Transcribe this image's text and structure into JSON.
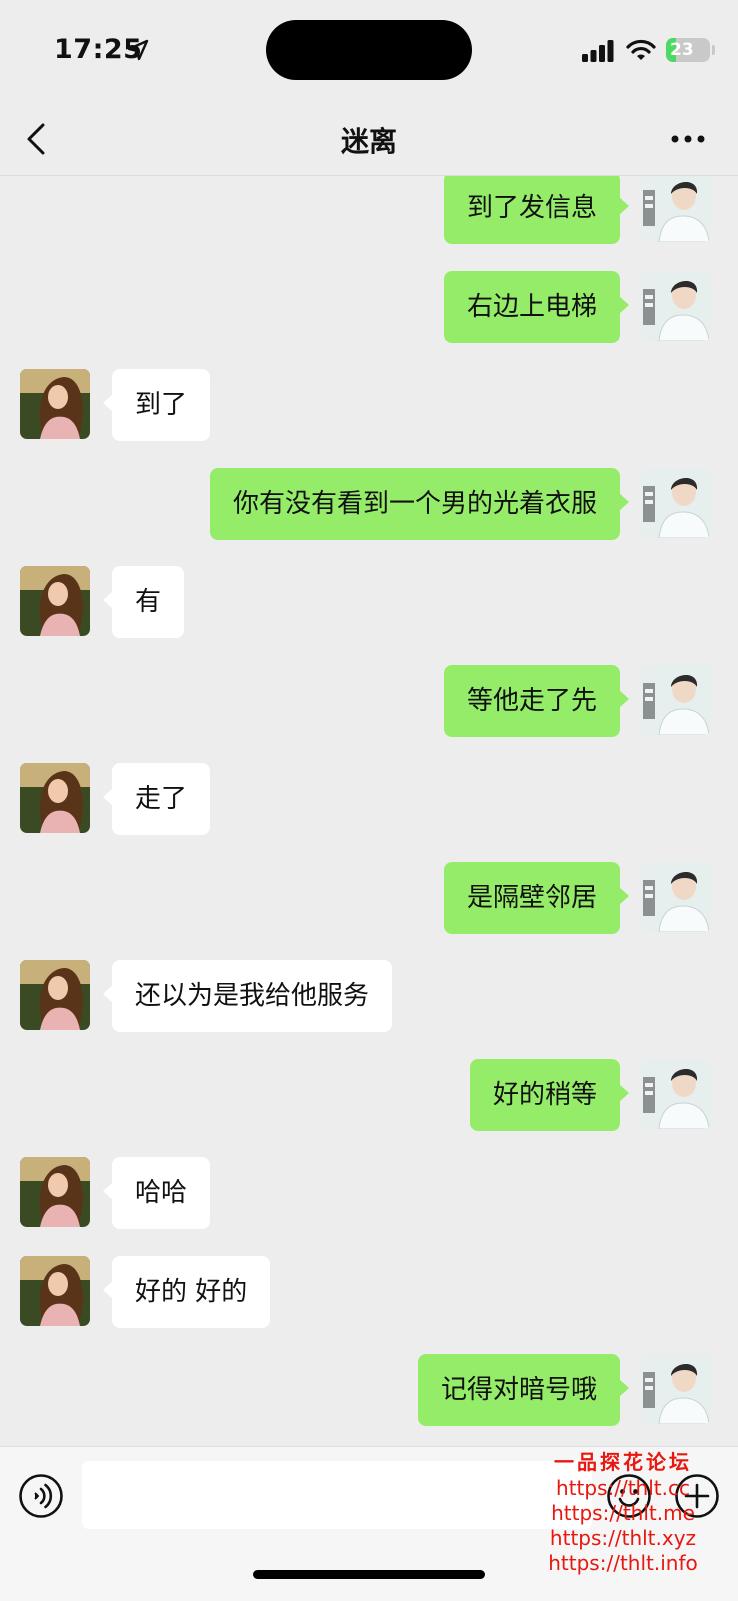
{
  "status_bar": {
    "time": "17:25",
    "battery": "23",
    "battery_level": 0.23
  },
  "header": {
    "title": "迷离"
  },
  "messages": [
    {
      "side": "sent",
      "text": "到了发信息"
    },
    {
      "side": "sent",
      "text": "右边上电梯"
    },
    {
      "side": "recv",
      "text": "到了"
    },
    {
      "side": "sent",
      "text": "你有没有看到一个男的光着衣服"
    },
    {
      "side": "recv",
      "text": "有"
    },
    {
      "side": "sent",
      "text": "等他走了先"
    },
    {
      "side": "recv",
      "text": "走了"
    },
    {
      "side": "sent",
      "text": "是隔壁邻居"
    },
    {
      "side": "recv",
      "text": "还以为是我给他服务"
    },
    {
      "side": "sent",
      "text": "好的稍等"
    },
    {
      "side": "recv",
      "text": "哈哈"
    },
    {
      "side": "recv",
      "text": "好的 好的"
    },
    {
      "side": "sent",
      "text": "记得对暗号哦"
    }
  ],
  "input": {
    "value": ""
  },
  "watermark": {
    "title": "一品探花论坛",
    "lines": [
      "https://thlt.cc",
      "https://thlt.me",
      "https://thlt.xyz",
      "https://thlt.info"
    ]
  },
  "colors": {
    "sent_bubble": "#95ec69",
    "recv_bubble": "#ffffff",
    "background": "#ededed",
    "watermark": "#e8170f"
  },
  "icons": [
    "location-arrow-icon",
    "signal-icon",
    "wifi-icon",
    "back-chevron-icon",
    "more-dots-icon",
    "voice-icon",
    "emoji-icon",
    "plus-icon"
  ]
}
